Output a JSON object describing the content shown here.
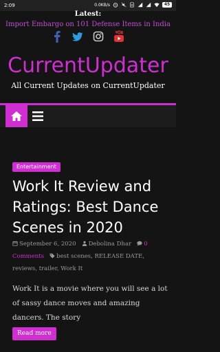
{
  "status_bar": {
    "time": "2:09",
    "network_speed": "0.0KB/s",
    "battery": "45"
  },
  "ticker": {
    "label": "Latest:",
    "headline": "Import Embargo on 101 Defense Items in India"
  },
  "socials": [
    "facebook-icon",
    "twitter-icon",
    "instagram-icon",
    "youtube-icon"
  ],
  "site": {
    "name": "CurrentUpdater",
    "tagline": "All Current Updates on CurrentUpdater"
  },
  "article": {
    "category": "Entertainment",
    "title": "Work It Review and Ratings: Best Dance Scenes in 2020",
    "date": "September 6, 2020",
    "author": "Debolina Dhar",
    "comments_count": "0",
    "comments_label": "Comments",
    "tags": [
      "best scenes",
      "RELEASE DATE",
      "reviews",
      "trailer",
      "Work It"
    ],
    "excerpt": "Work It is a movie where you will see a lot of sassy dance moves and amazing dancers. The story",
    "read_more": "Read more"
  },
  "colors": {
    "accent": "#cf2fd0",
    "background": "#141414",
    "ticker_text": "#c24fd6"
  }
}
